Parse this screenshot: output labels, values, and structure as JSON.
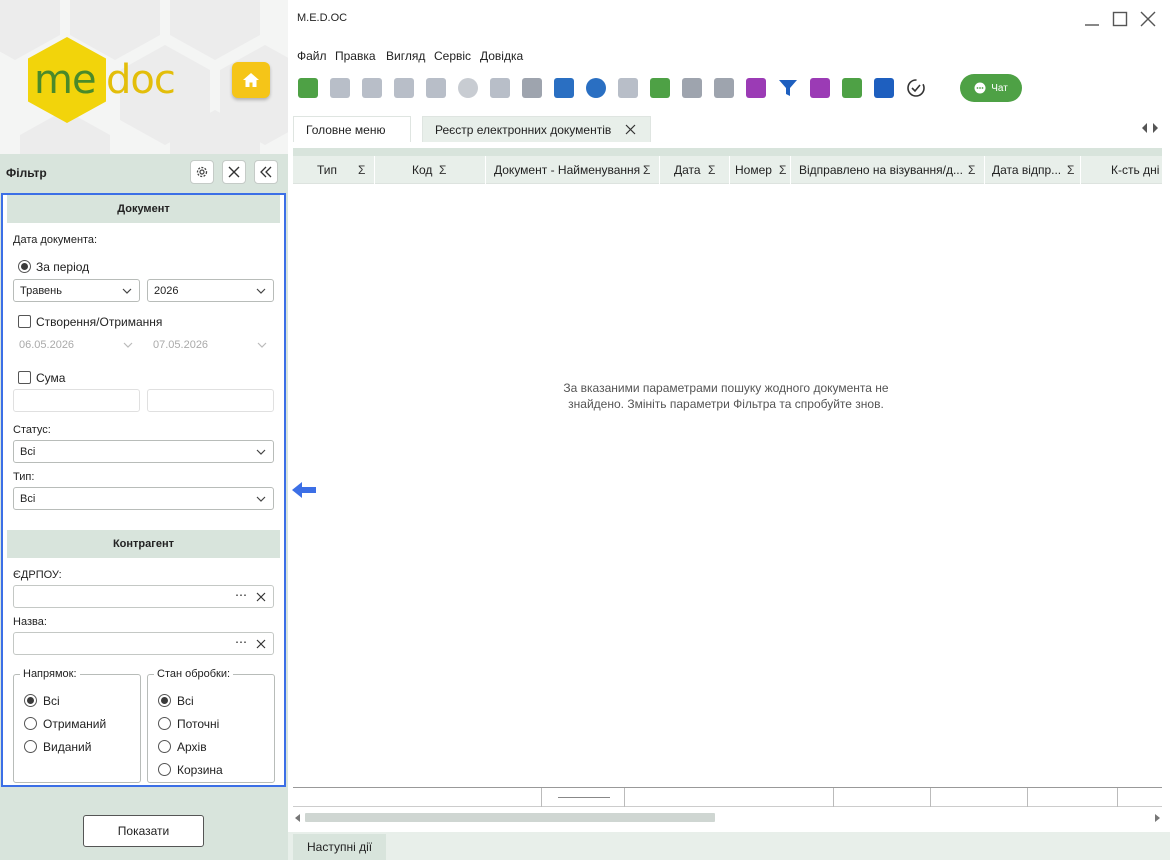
{
  "app": {
    "title": "M.E.D.OC",
    "logo_me": "me",
    "logo_doc": "doc"
  },
  "menu": [
    "Файл",
    "Правка",
    "Вигляд",
    "Сервіс",
    "Довідка"
  ],
  "toolbar": {
    "chat_label": "Чат"
  },
  "tabs": [
    {
      "label": "Головне меню"
    },
    {
      "label": "Реєстр електронних документів"
    }
  ],
  "filter": {
    "title": "Фільтр",
    "document_section": "Документ",
    "date_label": "Дата документа:",
    "period_label": "За період",
    "month": "Травень",
    "year": "2026",
    "creation_label": "Створення/Отримання",
    "date_from": "06.05.2026",
    "date_to": "07.05.2026",
    "sum_label": "Сума",
    "status_label": "Статус:",
    "status_value": "Всі",
    "type_label": "Тип:",
    "type_value": "Всі",
    "counterparty_section": "Контрагент",
    "edrpou_label": "ЄДРПОУ:",
    "name_label": "Назва:",
    "direction": {
      "legend": "Напрямок:",
      "options": [
        "Всі",
        "Отриманий",
        "Виданий"
      ]
    },
    "processing": {
      "legend": "Стан обробки:",
      "options": [
        "Всі",
        "Поточні",
        "Архів",
        "Корзина"
      ]
    },
    "show_button": "Показати"
  },
  "grid": {
    "columns": [
      "Тип",
      "Код",
      "Документ - Найменування",
      "Дата",
      "Номер",
      "Відправлено на  візування/д...",
      "Дата відпр...",
      "К-сть дні"
    ],
    "sigma": "Σ",
    "empty_message": "За вказаними параметрами пошуку жодного документа не знайдено. Змініть параметри Фільтра та спробуйте знов."
  },
  "bottom": {
    "next_actions": "Наступні дії"
  },
  "colors": {
    "accent_green": "#4ea145",
    "header_bg": "#d8e4dc",
    "highlight_border": "#3c6fe6"
  }
}
